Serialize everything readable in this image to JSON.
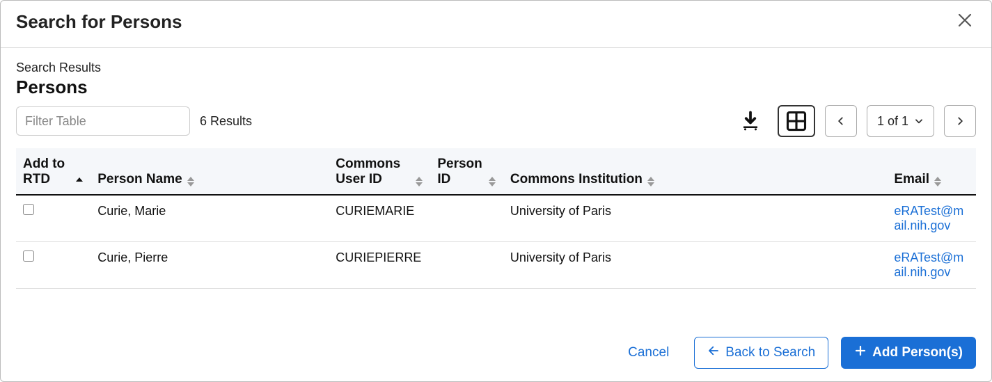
{
  "modal": {
    "title": "Search for Persons"
  },
  "body": {
    "search_results_label": "Search Results",
    "persons_heading": "Persons",
    "filter_placeholder": "Filter Table",
    "results_count": "6 Results",
    "pagination": {
      "label": "1 of 1"
    }
  },
  "columns": {
    "add_to_rtd": "Add to RTD",
    "person_name": "Person Name",
    "commons_user_id": "Commons User ID",
    "person_id": "Person ID",
    "commons_institution": "Commons Institution",
    "email": "Email"
  },
  "rows": [
    {
      "person_name": "Curie, Marie",
      "commons_user_id": "CURIEMARIE",
      "person_id": "",
      "commons_institution": "University of Paris",
      "email": "eRATest@mail.nih.gov"
    },
    {
      "person_name": "Curie, Pierre",
      "commons_user_id": "CURIEPIERRE",
      "person_id": "",
      "commons_institution": "University of Paris",
      "email": "eRATest@mail.nih.gov"
    }
  ],
  "footer": {
    "cancel": "Cancel",
    "back_to_search": "Back to Search",
    "add_persons": "Add Person(s)"
  }
}
